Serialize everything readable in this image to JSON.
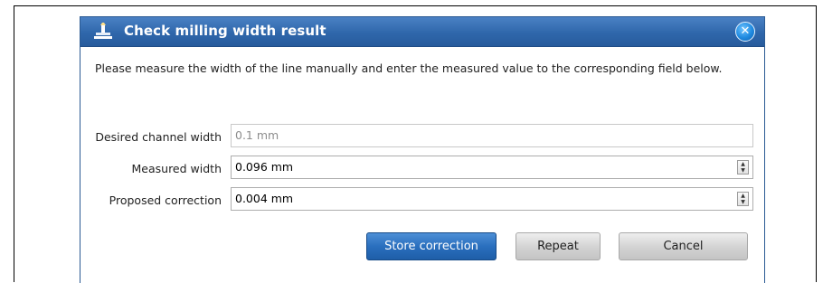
{
  "dialog": {
    "title": "Check milling width result",
    "app_icon": "milling-tool-icon",
    "close_icon": "close-icon",
    "close_label": "✕",
    "message": "Please measure the width of the line manually and enter the measured value to the corresponding field below."
  },
  "fields": {
    "desired_width": {
      "label": "Desired channel width",
      "value": "0.1 mm"
    },
    "measured_width": {
      "label": "Measured width",
      "value": "0.096 mm"
    },
    "proposed_correction": {
      "label": "Proposed correction",
      "value": "0.004 mm"
    }
  },
  "spinner": {
    "up": "▲",
    "down": "▼"
  },
  "buttons": {
    "store": "Store correction",
    "repeat": "Repeat",
    "cancel": "Cancel"
  },
  "colors": {
    "titlebar": "#2f67ab",
    "primary_button": "#2a6fbe",
    "close_button": "#1f8ae0"
  }
}
